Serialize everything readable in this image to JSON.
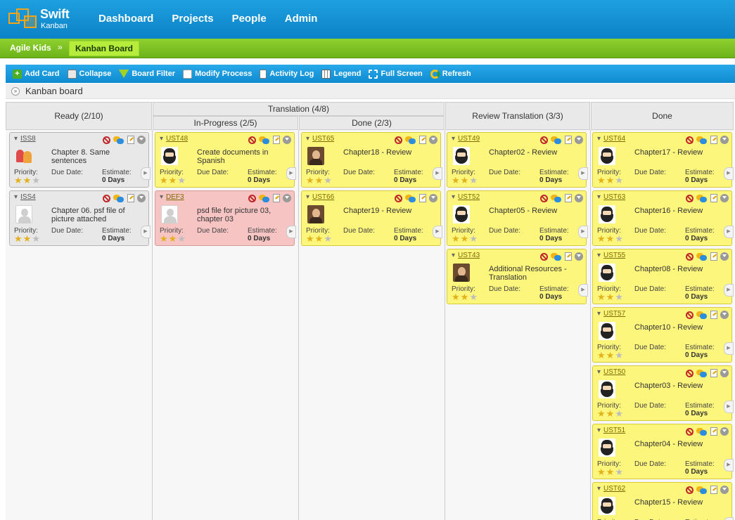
{
  "app": {
    "logo_line1": "Swift",
    "logo_line2": "Kanban"
  },
  "nav": [
    "Dashboard",
    "Projects",
    "People",
    "Admin"
  ],
  "breadcrumb": {
    "project": "Agile Kids",
    "separator": "»",
    "current": "Kanban Board"
  },
  "toolbar": [
    "Add Card",
    "Collapse",
    "Board Filter",
    "Modify Process",
    "Activity Log",
    "Legend",
    "Full Screen",
    "Refresh"
  ],
  "board_title": "Kanban board",
  "columns": {
    "ready": "Ready (2/10)",
    "translation": "Translation (4/8)",
    "in_progress": "In-Progress (2/5)",
    "done_sub": "Done (2/3)",
    "review": "Review Translation (3/3)",
    "done": "Done"
  },
  "labels": {
    "priority": "Priority:",
    "due": "Due Date:",
    "estimate": "Estimate:"
  },
  "cards": [
    {
      "col": 0,
      "row": 0,
      "id": "ISS8",
      "title": "Chapter 8. Same sentences",
      "avatar": "kids",
      "color": "gray",
      "stars": 2,
      "estimate": "0 Days"
    },
    {
      "col": 0,
      "row": 1,
      "id": "ISS4",
      "title": "Chapter 06. psf file of picture attached",
      "avatar": "blank",
      "color": "gray",
      "stars": 2,
      "estimate": "0 Days"
    },
    {
      "col": 1,
      "row": 0,
      "id": "UST48",
      "title": "Create documents in Spanish",
      "avatar": "beard",
      "color": "yellow",
      "stars": 2,
      "estimate": "0 Days"
    },
    {
      "col": 1,
      "row": 1,
      "id": "DEF3",
      "title": "psd file for picture 03, chapter 03",
      "avatar": "blank",
      "color": "red",
      "stars": 2,
      "estimate": "0 Days"
    },
    {
      "col": 2,
      "row": 0,
      "id": "UST65",
      "title": "Chapter18 - Review",
      "avatar": "woman",
      "color": "yellow",
      "stars": 2,
      "estimate": "0 Days"
    },
    {
      "col": 2,
      "row": 1,
      "id": "UST66",
      "title": "Chapter19 - Review",
      "avatar": "woman",
      "color": "yellow",
      "stars": 2,
      "estimate": "0 Days"
    },
    {
      "col": 3,
      "row": 0,
      "id": "UST49",
      "title": "Chapter02 - Review",
      "avatar": "beard",
      "color": "yellow",
      "stars": 2,
      "estimate": "0 Days"
    },
    {
      "col": 3,
      "row": 1,
      "id": "UST52",
      "title": "Chapter05 - Review",
      "avatar": "beard",
      "color": "yellow",
      "stars": 2,
      "estimate": "0 Days"
    },
    {
      "col": 3,
      "row": 2,
      "id": "UST43",
      "title": "Additional Resources - Translation",
      "avatar": "woman",
      "color": "yellow",
      "stars": 2,
      "estimate": "0 Days"
    },
    {
      "col": 4,
      "row": 0,
      "id": "UST64",
      "title": "Chapter17 - Review",
      "avatar": "beard",
      "color": "yellow",
      "stars": 2,
      "estimate": "0 Days"
    },
    {
      "col": 4,
      "row": 1,
      "id": "UST63",
      "title": "Chapter16 - Review",
      "avatar": "beard",
      "color": "yellow",
      "stars": 2,
      "estimate": "0 Days"
    },
    {
      "col": 4,
      "row": 2,
      "id": "UST55",
      "title": "Chapter08 - Review",
      "avatar": "beard",
      "color": "yellow",
      "stars": 2,
      "estimate": "0 Days"
    },
    {
      "col": 4,
      "row": 3,
      "id": "UST57",
      "title": "Chapter10 - Review",
      "avatar": "beard",
      "color": "yellow",
      "stars": 2,
      "estimate": "0 Days"
    },
    {
      "col": 4,
      "row": 4,
      "id": "UST50",
      "title": "Chapter03 - Review",
      "avatar": "beard",
      "color": "yellow",
      "stars": 2,
      "estimate": "0 Days"
    },
    {
      "col": 4,
      "row": 5,
      "id": "UST51",
      "title": "Chapter04 - Review",
      "avatar": "beard",
      "color": "yellow",
      "stars": 2,
      "estimate": "0 Days"
    },
    {
      "col": 4,
      "row": 6,
      "id": "UST62",
      "title": "Chapter15 - Review",
      "avatar": "beard",
      "color": "yellow",
      "stars": 2,
      "estimate": ""
    }
  ]
}
